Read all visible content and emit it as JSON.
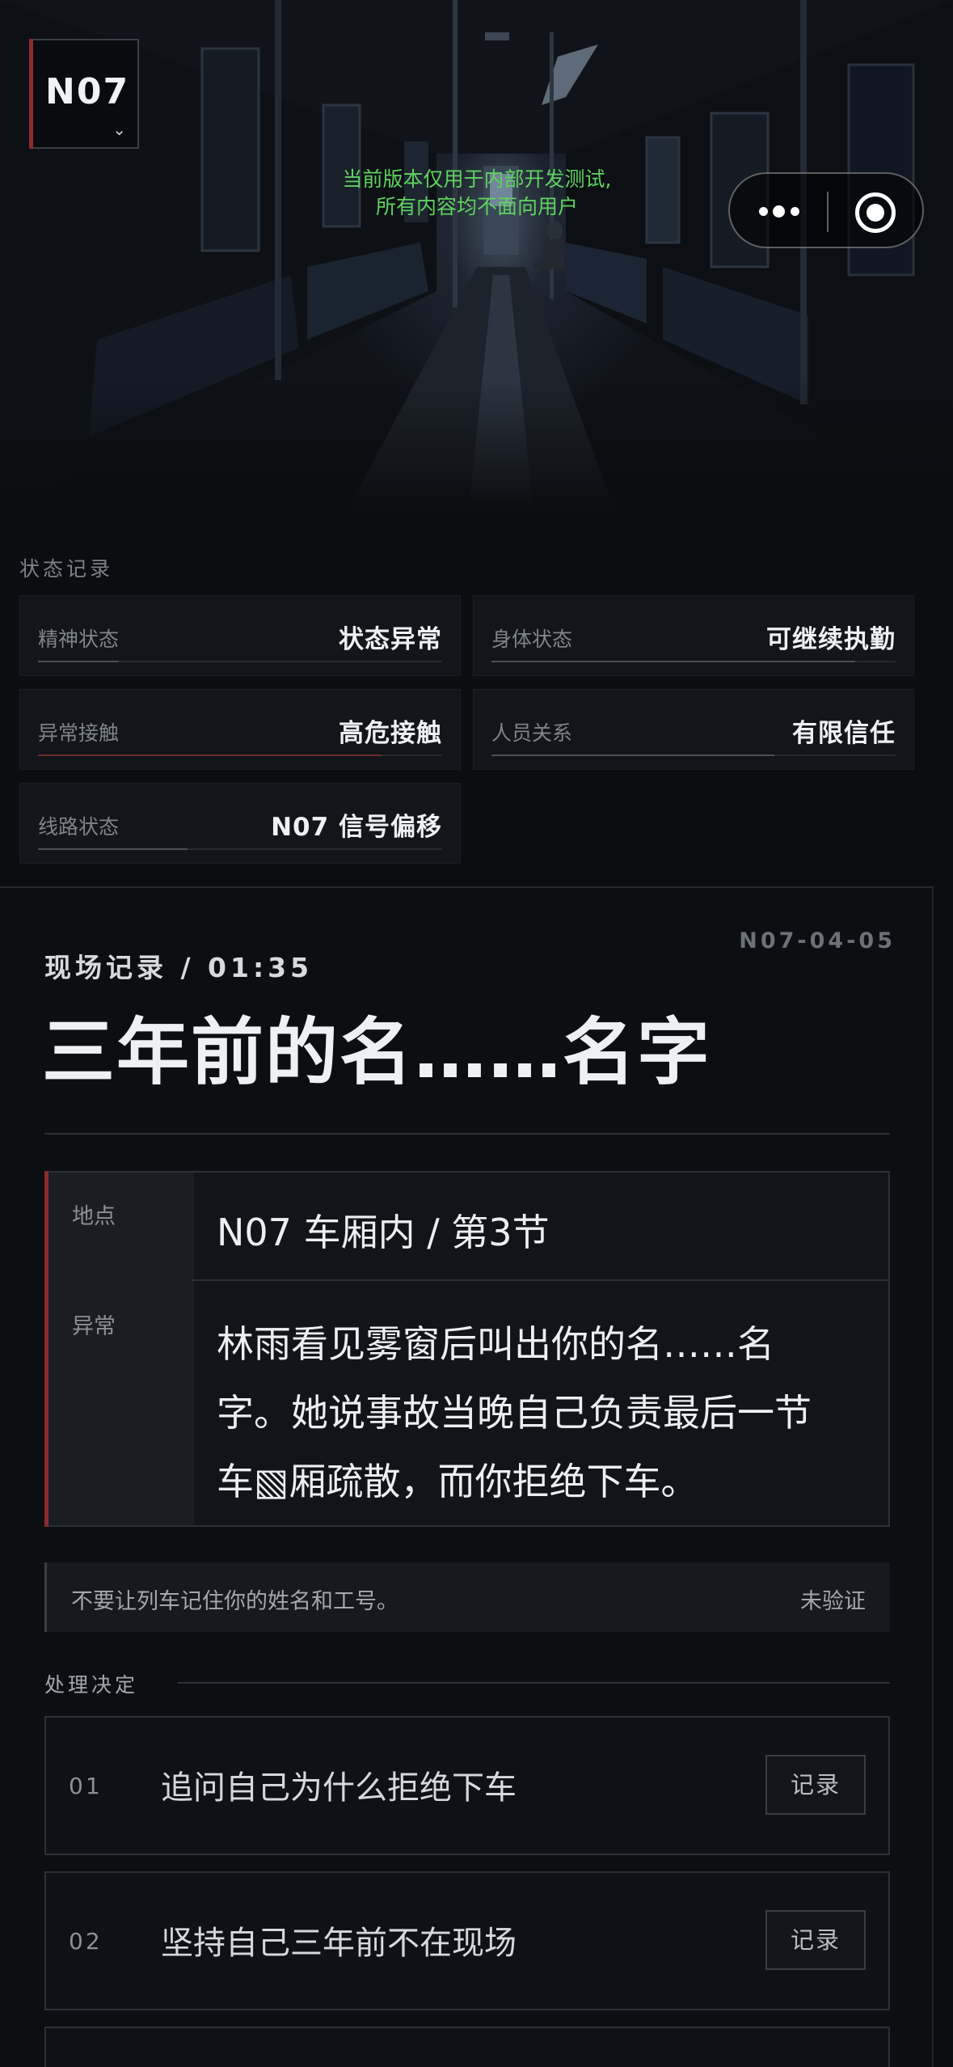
{
  "hero": {
    "logo": "N07",
    "notice_line1": "当前版本仅用于内部开发测试,",
    "notice_line2": "所有内容均不面向用户"
  },
  "colors": {
    "accent_red": "#8c2a2e",
    "notice_green": "#5fd35f",
    "bar_gray": "#4a4f57"
  },
  "status": {
    "section_title": "状态记录",
    "items": [
      {
        "label": "精神状态",
        "value": "状态异常",
        "level": 0.2,
        "color": "#4a4f57"
      },
      {
        "label": "身体状态",
        "value": "可继续执勤",
        "level": 0.9,
        "color": "#4a4f57"
      },
      {
        "label": "异常接触",
        "value": "高危接触",
        "level": 0.85,
        "color": "#6e2a2d"
      },
      {
        "label": "人员关系",
        "value": "有限信任",
        "level": 0.7,
        "color": "#4a4f57"
      },
      {
        "label": "线路状态",
        "value": "N07 信号偏移",
        "level": 0.37,
        "color": "#4a4f57"
      }
    ]
  },
  "record": {
    "header": "现场记录 / 01:35",
    "id": "N07-04-05",
    "title": "三年前的名……名字",
    "location_label": "地点",
    "location_value": "N07 车厢内 / 第3节",
    "anomaly_label": "异常",
    "anomaly_line1": "林雨看见雾窗后叫出你的名……名",
    "anomaly_line2": "字。她说事故当晚自己负责最后一节",
    "anomaly_line3": "车▧厢疏散，而你拒绝下车。",
    "warning": "不要让列车记住你的姓名和工号。",
    "warning_status": "未验证"
  },
  "decision": {
    "title": "处理决定",
    "options": [
      {
        "num": "01",
        "text": "追问自己为什么拒绝下车",
        "button": "记录"
      },
      {
        "num": "02",
        "text": "坚持自己三年前不在现场",
        "button": "记录"
      }
    ]
  },
  "icons": {
    "more": "more-dots-icon",
    "close": "mini-program-close-icon",
    "chevron": "chevron-down-icon"
  }
}
